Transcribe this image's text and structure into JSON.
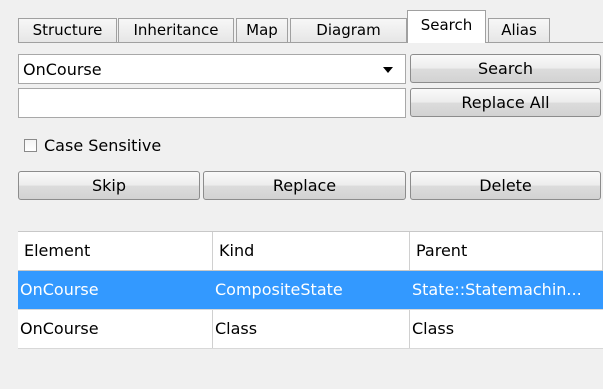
{
  "tabs": [
    {
      "label": "Structure"
    },
    {
      "label": "Inheritance"
    },
    {
      "label": "Map"
    },
    {
      "label": "Diagram"
    },
    {
      "label": "Search",
      "active": true
    },
    {
      "label": "Alias"
    }
  ],
  "search": {
    "combo_value": "OnCourse",
    "replace_value": "",
    "search_button": "Search",
    "replace_all_button": "Replace All",
    "case_sensitive_label": "Case Sensitive",
    "case_sensitive_checked": false,
    "skip_button": "Skip",
    "replace_button": "Replace",
    "delete_button": "Delete"
  },
  "results": {
    "columns": [
      "Element",
      "Kind",
      "Parent"
    ],
    "rows": [
      {
        "element": "OnCourse",
        "kind": "CompositeState",
        "parent": "State::Statemachin...",
        "selected": true
      },
      {
        "element": "OnCourse",
        "kind": "Class",
        "parent": "Class",
        "selected": false
      }
    ]
  },
  "colors": {
    "selection": "#3399ff",
    "panel_background": "#f0f0f0"
  }
}
